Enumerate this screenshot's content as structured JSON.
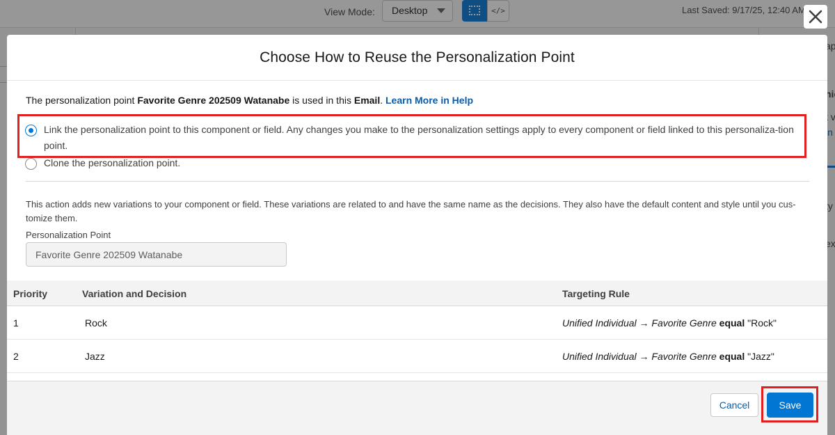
{
  "background": {
    "view_mode_label": "View Mode:",
    "view_mode_value": "Desktop",
    "code_view_label": "</>",
    "last_saved": "Last Saved: 9/17/25, 12:40 AM",
    "right_edge_fragments": [
      "ap",
      "nic",
      "t v",
      "in",
      "ty",
      "ex"
    ]
  },
  "modal": {
    "title": "Choose How to Reuse the Personalization Point",
    "intro": {
      "prefix": "The personalization point ",
      "point_name": "Favorite Genre 202509 Watanabe",
      "middle": " is used in this ",
      "content_type": "Email",
      "suffix": ". ",
      "help_link": "Learn More in Help"
    },
    "options": [
      {
        "label": "Link the personalization point to this component or field. Any changes you make to the personalization settings apply to every component or field linked to this personaliza-tion point.",
        "selected": true
      },
      {
        "label": "Clone the personalization point.",
        "selected": false
      }
    ],
    "action_description": "This action adds new variations to your component or field. These variations are related to and have the same name as the decisions. They also have the default content and style until you cus-tomize them.",
    "personalization_point_label": "Personalization Point",
    "personalization_point_value": "Favorite Genre 202509 Watanabe",
    "table": {
      "headers": [
        "Priority",
        "Variation and Decision",
        "Targeting Rule"
      ],
      "rows": [
        {
          "priority": "1",
          "variation": "Rock",
          "rule_path": "Unified Individual → Favorite Genre",
          "rule_op": "equal",
          "rule_value": "\"Rock\""
        },
        {
          "priority": "2",
          "variation": "Jazz",
          "rule_path": "Unified Individual → Favorite Genre",
          "rule_op": "equal",
          "rule_value": "\"Jazz\""
        }
      ]
    },
    "buttons": {
      "cancel": "Cancel",
      "save": "Save"
    }
  },
  "colors": {
    "brand_blue": "#0176d3",
    "link_blue": "#0b5cab",
    "highlight_red": "#e0201f"
  },
  "icons": {
    "close": "close-icon",
    "design_view": "design-view-icon",
    "dropdown": "chevron-down-icon"
  }
}
